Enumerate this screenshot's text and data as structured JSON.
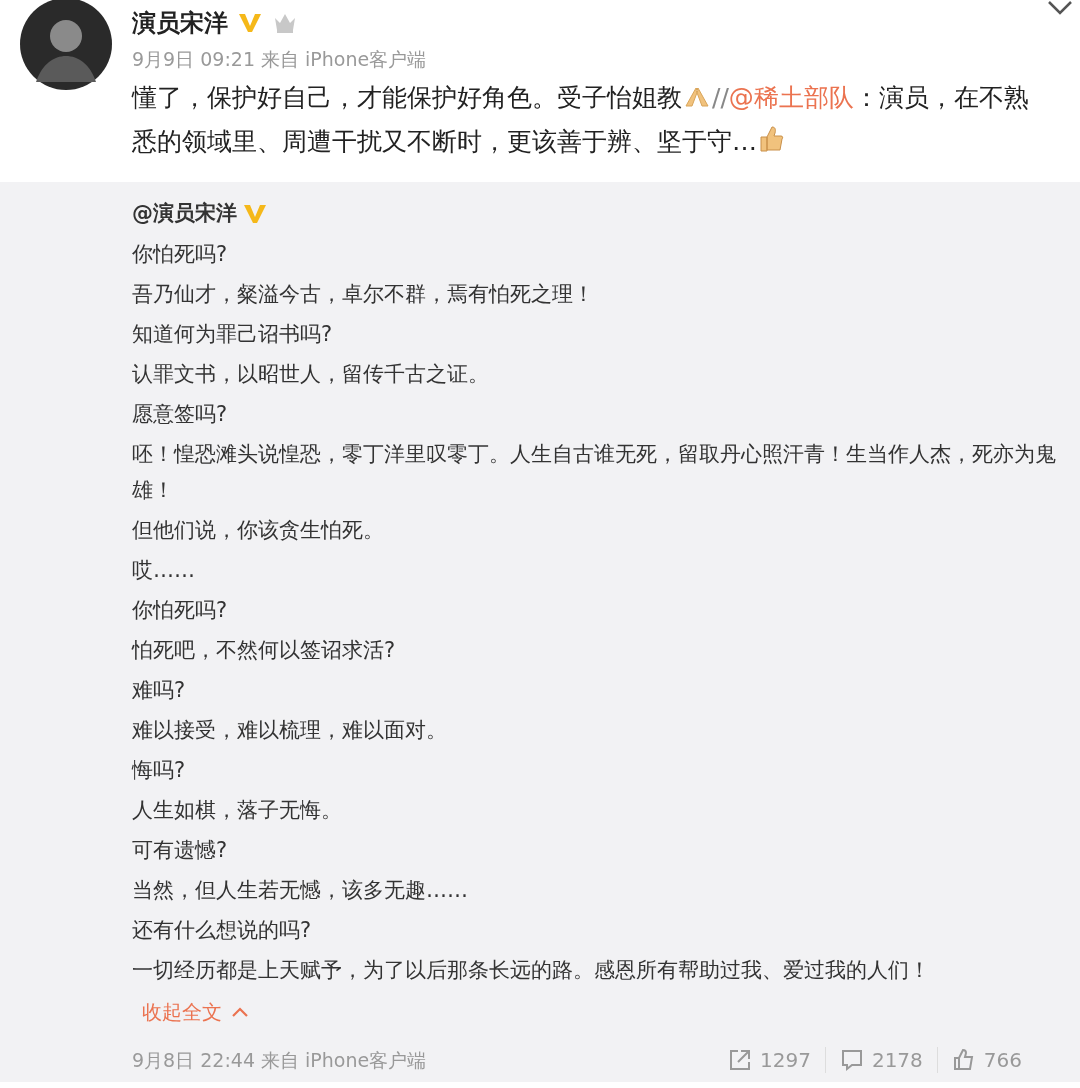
{
  "post": {
    "author": "演员宋洋",
    "verified": true,
    "crown": true,
    "meta": "9月9日 09:21 来自 iPhone客户端",
    "body": {
      "before": "懂了，保护好自己，才能保护好角色。受子怡姐教",
      "slashes": "//",
      "mention": "@稀土部队",
      "after": "：演员，在不熟悉的领域里、周遭干扰又不断时，更该善于辨、坚于守…"
    }
  },
  "repost": {
    "author": "@演员宋洋",
    "verified": true,
    "lines": [
      "你怕死吗?",
      "吾乃仙才，粲溢今古，卓尔不群，焉有怕死之理！",
      "知道何为罪己诏书吗?",
      "认罪文书，以昭世人，留传千古之证。",
      "愿意签吗?",
      "呸！惶恐滩头说惶恐，零丁洋里叹零丁。人生自古谁无死，留取丹心照汗青！生当作人杰，死亦为鬼雄！",
      "但他们说，你该贪生怕死。",
      "哎……",
      "你怕死吗?",
      "怕死吧，不然何以签诏求活?",
      "难吗?",
      "难以接受，难以梳理，难以面对。",
      "悔吗?",
      "人生如棋，落子无悔。",
      "可有遗憾?",
      "当然，但人生若无憾，该多无趣……",
      "还有什么想说的吗?",
      "一切经历都是上天赋予，为了以后那条长远的路。感恩所有帮助过我、爱过我的人们！"
    ],
    "collapse": "收起全文",
    "meta": "9月8日 22:44 来自 iPhone客户端",
    "stats": [
      {
        "kind": "share",
        "count": "1297"
      },
      {
        "kind": "comment",
        "count": "2178"
      },
      {
        "kind": "like",
        "count": "766"
      }
    ]
  }
}
